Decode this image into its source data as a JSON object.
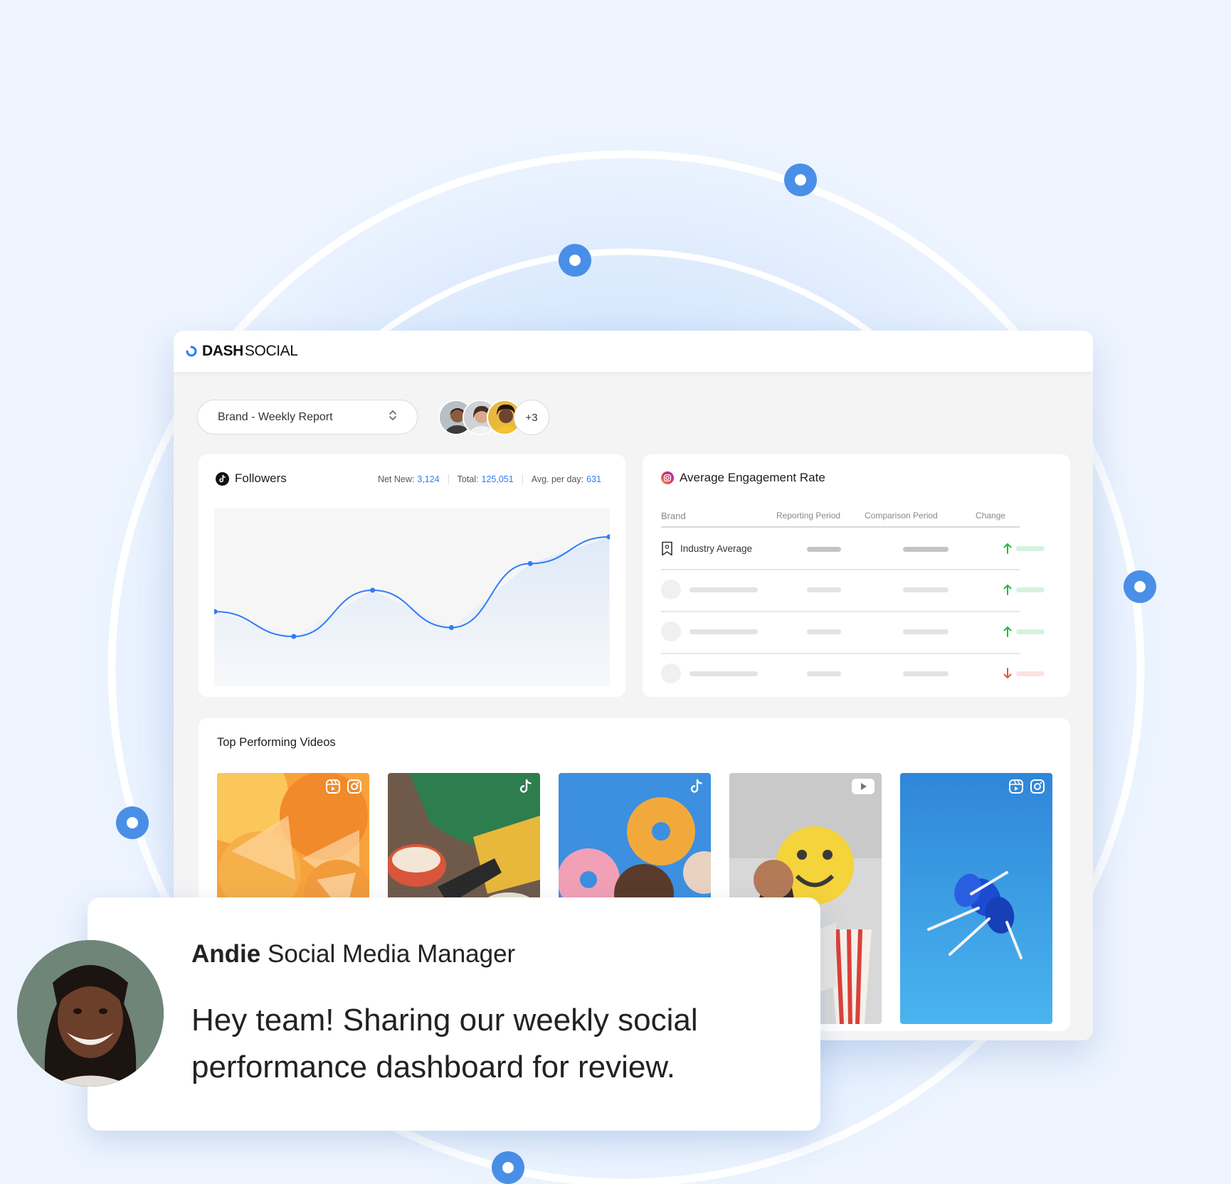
{
  "brand": {
    "name_bold": "DASH",
    "name_light": "SOCIAL",
    "accent": "#2f7cf6"
  },
  "report": {
    "label": "Brand - Weekly Report",
    "chevron_icon": "chevron-up-down-icon"
  },
  "collaborators": {
    "more_label": "+3"
  },
  "followers": {
    "title": "Followers",
    "platform_icon": "tiktok-icon",
    "net_new_label": "Net New:",
    "net_new_value": "3,124",
    "total_label": "Total:",
    "total_value": "125,051",
    "avg_label": "Avg. per day:",
    "avg_value": "631",
    "chart_data": {
      "type": "line",
      "x": [
        0,
        1,
        2,
        3,
        4,
        5
      ],
      "series": [
        {
          "values": [
            0.42,
            0.28,
            0.54,
            0.33,
            0.69,
            0.84
          ]
        }
      ],
      "ylim": [
        0,
        1
      ],
      "grid": false,
      "title": "",
      "xlabel": "",
      "ylabel": ""
    }
  },
  "engagement": {
    "title": "Average Engagement Rate",
    "platform_icon": "instagram-icon",
    "columns": [
      "Brand",
      "Reporting Period",
      "Comparison Period",
      "Change"
    ],
    "rows": [
      {
        "label": "Industry Average",
        "icon": "bookmark-icon",
        "change": "up"
      },
      {
        "label": "",
        "change": "up"
      },
      {
        "label": "",
        "change": "up"
      },
      {
        "label": "",
        "change": "down"
      }
    ],
    "up_color": "#22b845",
    "down_color": "#e5533d"
  },
  "videos": {
    "title": "Top Performing Videos",
    "items": [
      {
        "name": "citrus-candy",
        "platforms": [
          "instagram-reels-icon",
          "instagram-icon"
        ]
      },
      {
        "name": "snacks-remote",
        "platforms": [
          "tiktok-icon"
        ]
      },
      {
        "name": "donuts",
        "platforms": [
          "tiktok-icon"
        ]
      },
      {
        "name": "woman-popcorn",
        "platforms": [
          "youtube-icon"
        ]
      },
      {
        "name": "blue-lollipops",
        "platforms": [
          "instagram-reels-icon",
          "instagram-icon"
        ]
      }
    ]
  },
  "message": {
    "sender_name": "Andie",
    "sender_role": "Social Media Manager",
    "text": "Hey team! Sharing our weekly social performance dashboard for review."
  }
}
